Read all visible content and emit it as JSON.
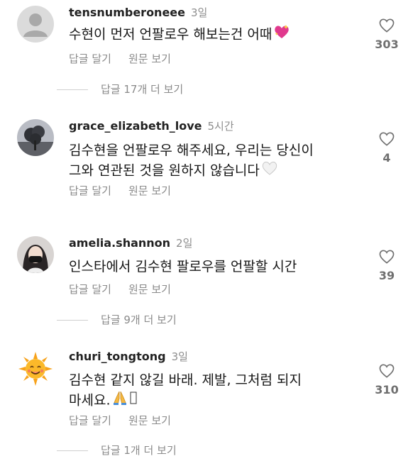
{
  "comments": [
    {
      "username": "tensnumberoneee",
      "time": "3일",
      "text": "수현이 먼저 언팔로우 해보는건 어때",
      "emoji": "sparkling-heart",
      "reply_label": "답글 달기",
      "translate_label": "원문 보기",
      "likes": "303",
      "view_replies": "답글 17개 더 보기",
      "avatar": "default-person-icon"
    },
    {
      "username": "grace_elizabeth_love",
      "time": "5시간",
      "text_line1": "김수현을 언팔로우 해주세요, 우리는 당신이",
      "text_line2": "그와 연관된 것을 원하지 않습니다",
      "emoji": "white-heart",
      "reply_label": "답글 달기",
      "translate_label": "원문 보기",
      "likes": "4",
      "avatar": "tree-photo"
    },
    {
      "username": "amelia.shannon",
      "time": "2일",
      "text": "인스타에서 김수현 팔로우를 언팔할 시간",
      "reply_label": "답글 달기",
      "translate_label": "원문 보기",
      "likes": "39",
      "view_replies": "답글 9개 더 보기",
      "avatar": "girl-photo"
    },
    {
      "username": "churi_tongtong",
      "time": "3일",
      "text_line1": "김수현 같지 않길 바래. 제발, 그처럼 되지",
      "text_line2": "마세요.",
      "emoji": "folded-hands",
      "reply_label": "답글 달기",
      "translate_label": "원문 보기",
      "likes": "310",
      "view_replies": "답글 1개 더 보기",
      "avatar": "sun-emoji"
    }
  ],
  "colors": {
    "text": "#161616",
    "secondary": "#8a8a8a",
    "like_count": "#6f6f6f"
  }
}
